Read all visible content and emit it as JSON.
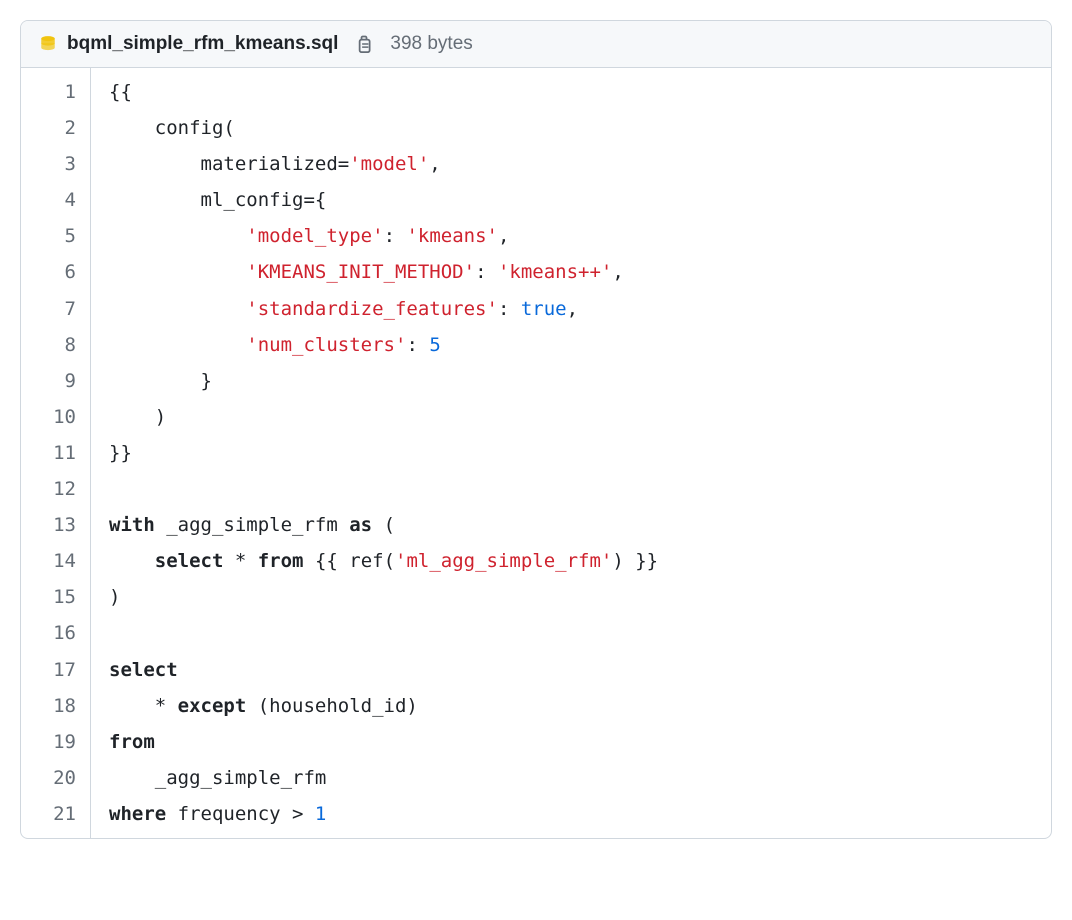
{
  "header": {
    "filename": "bqml_simple_rfm_kmeans.sql",
    "filesize": "398 bytes"
  },
  "code": {
    "lines": [
      [
        {
          "t": "{{",
          "c": ""
        }
      ],
      [
        {
          "t": "    config(",
          "c": ""
        }
      ],
      [
        {
          "t": "        materialized=",
          "c": ""
        },
        {
          "t": "'model'",
          "c": "tok-str"
        },
        {
          "t": ",",
          "c": ""
        }
      ],
      [
        {
          "t": "        ml_config={",
          "c": ""
        }
      ],
      [
        {
          "t": "            ",
          "c": ""
        },
        {
          "t": "'model_type'",
          "c": "tok-str"
        },
        {
          "t": ": ",
          "c": ""
        },
        {
          "t": "'kmeans'",
          "c": "tok-str"
        },
        {
          "t": ",",
          "c": ""
        }
      ],
      [
        {
          "t": "            ",
          "c": ""
        },
        {
          "t": "'KMEANS_INIT_METHOD'",
          "c": "tok-str"
        },
        {
          "t": ": ",
          "c": ""
        },
        {
          "t": "'kmeans++'",
          "c": "tok-str"
        },
        {
          "t": ",",
          "c": ""
        }
      ],
      [
        {
          "t": "            ",
          "c": ""
        },
        {
          "t": "'standardize_features'",
          "c": "tok-str"
        },
        {
          "t": ": ",
          "c": ""
        },
        {
          "t": "true",
          "c": "tok-bool"
        },
        {
          "t": ",",
          "c": ""
        }
      ],
      [
        {
          "t": "            ",
          "c": ""
        },
        {
          "t": "'num_clusters'",
          "c": "tok-str"
        },
        {
          "t": ": ",
          "c": ""
        },
        {
          "t": "5",
          "c": "tok-num"
        }
      ],
      [
        {
          "t": "        }",
          "c": ""
        }
      ],
      [
        {
          "t": "    )",
          "c": ""
        }
      ],
      [
        {
          "t": "}}",
          "c": ""
        }
      ],
      [
        {
          "t": "",
          "c": ""
        }
      ],
      [
        {
          "t": "with",
          "c": "tok-kw"
        },
        {
          "t": " _agg_simple_rfm ",
          "c": ""
        },
        {
          "t": "as",
          "c": "tok-kw"
        },
        {
          "t": " (",
          "c": ""
        }
      ],
      [
        {
          "t": "    ",
          "c": ""
        },
        {
          "t": "select",
          "c": "tok-kw"
        },
        {
          "t": " * ",
          "c": ""
        },
        {
          "t": "from",
          "c": "tok-kw"
        },
        {
          "t": " {{ ref(",
          "c": ""
        },
        {
          "t": "'ml_agg_simple_rfm'",
          "c": "tok-str"
        },
        {
          "t": ") }}",
          "c": ""
        }
      ],
      [
        {
          "t": ")",
          "c": ""
        }
      ],
      [
        {
          "t": "",
          "c": ""
        }
      ],
      [
        {
          "t": "select",
          "c": "tok-kw"
        }
      ],
      [
        {
          "t": "    * ",
          "c": ""
        },
        {
          "t": "except",
          "c": "tok-kw"
        },
        {
          "t": " (household_id)",
          "c": ""
        }
      ],
      [
        {
          "t": "from",
          "c": "tok-kw"
        }
      ],
      [
        {
          "t": "    _agg_simple_rfm",
          "c": ""
        }
      ],
      [
        {
          "t": "where",
          "c": "tok-kw"
        },
        {
          "t": " frequency > ",
          "c": ""
        },
        {
          "t": "1",
          "c": "tok-num"
        }
      ]
    ]
  }
}
